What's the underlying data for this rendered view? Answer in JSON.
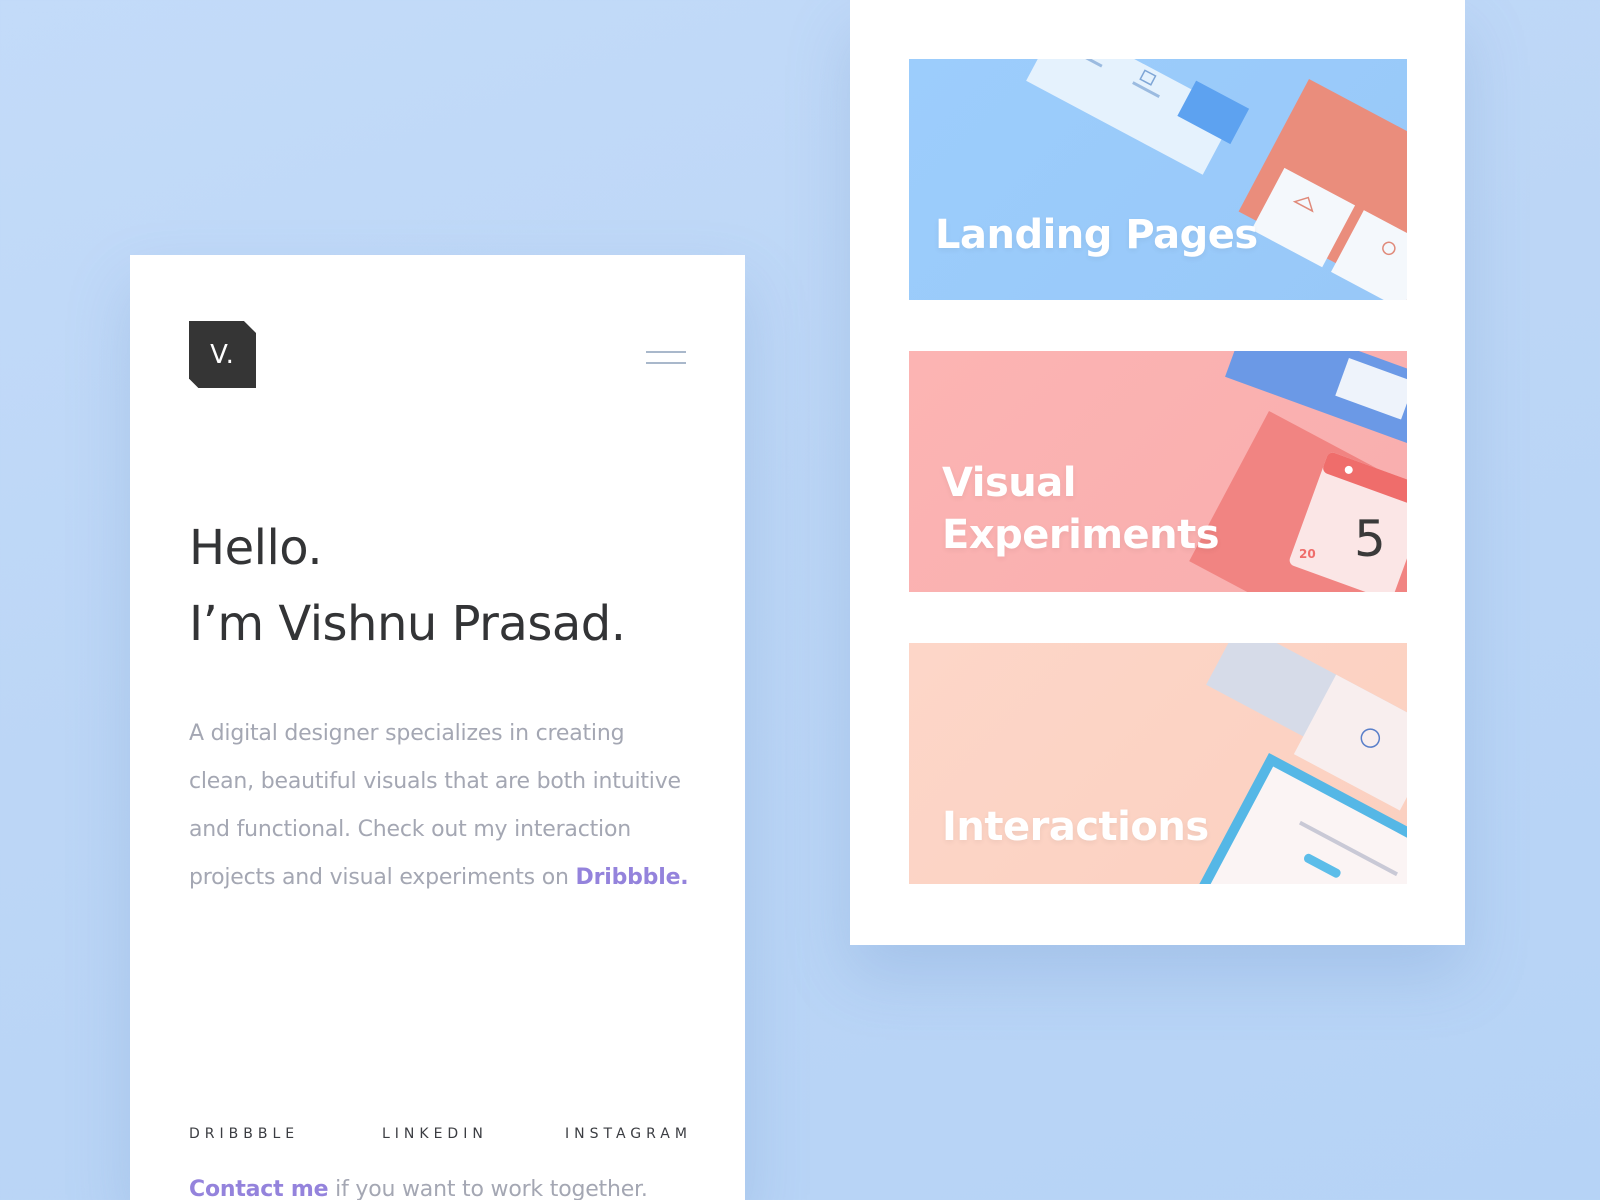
{
  "profile": {
    "logo_text": "V.",
    "greeting": "Hello.",
    "name_line": "I’m Vishnu Prasad.",
    "bio_text": "A digital designer specializes in creating clean, beautiful visuals that are both intuitive and functional. Check out my interaction projects and visual experiments on ",
    "bio_link": "Dribbble.",
    "contact_link": "Contact me",
    "contact_text": " if you want to work together."
  },
  "social": [
    "DRIBBBLE",
    "LINKEDIN",
    "INSTAGRAM"
  ],
  "portfolio": {
    "tiles": [
      {
        "title": "Landing Pages"
      },
      {
        "title_lines": [
          "Visual",
          "Experiments"
        ]
      },
      {
        "title": "Interactions"
      }
    ],
    "calendar": {
      "day": "5",
      "side": "20"
    }
  },
  "colors": {
    "background": "#bcd6f6",
    "accent": "#9483dc",
    "text_dark": "#333436",
    "text_muted": "#a4a7b3",
    "tile_landing": "#9ccdfc",
    "tile_visual": "#fcb4b3",
    "tile_interactions": "#fdd6c8"
  },
  "icons": [
    "logo-mark",
    "hamburger-menu-icon"
  ]
}
